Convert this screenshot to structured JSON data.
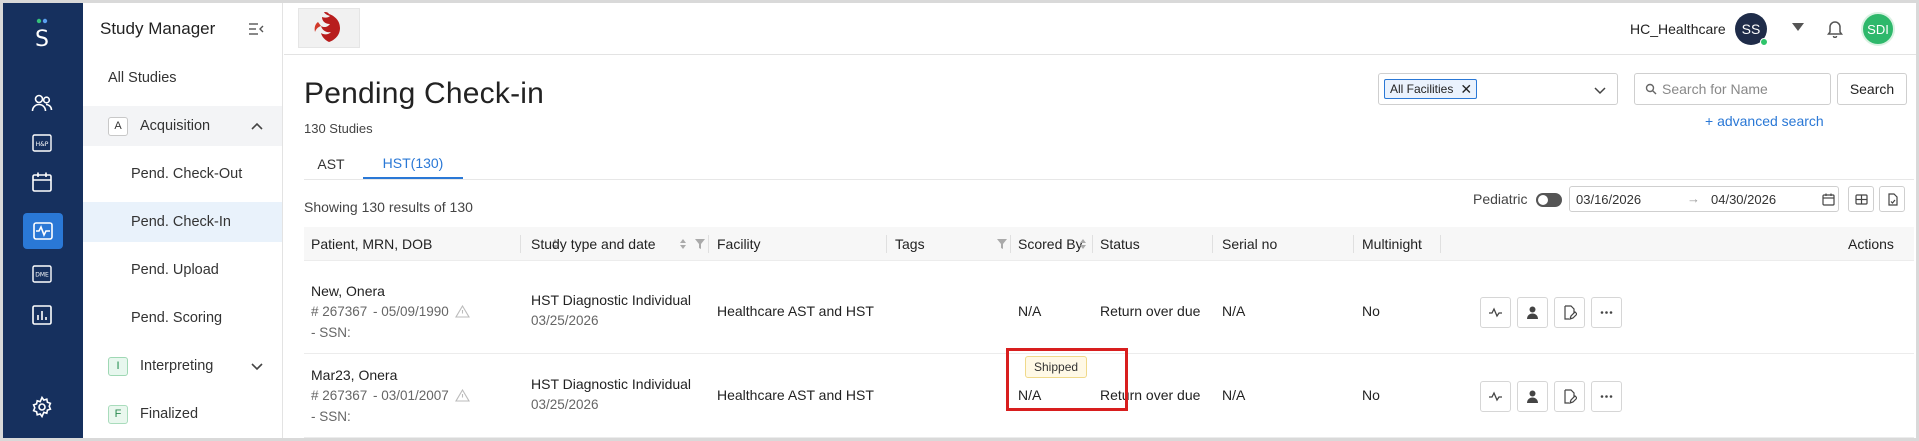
{
  "app": {
    "nav_title": "Study Manager",
    "logo_letter": "S"
  },
  "rail": {
    "icons": [
      "app-logo",
      "users-icon",
      "hp-icon",
      "calendar-icon",
      "studies-icon",
      "dme-icon",
      "reports-icon",
      "settings-icon"
    ],
    "hp_label": "H&P",
    "dme_label": "DME"
  },
  "nav": {
    "all_studies": "All Studies",
    "acquisition": {
      "badge": "A",
      "label": "Acquisition"
    },
    "sub_items": [
      "Pend. Check-Out",
      "Pend. Check-In",
      "Pend. Upload",
      "Pend. Scoring"
    ],
    "interpreting": {
      "badge": "I",
      "label": "Interpreting"
    },
    "finalized": {
      "badge": "F",
      "label": "Finalized"
    }
  },
  "header": {
    "org_name": "HC_Healthcare",
    "avatar_initials": "SS",
    "user_initials": "SDI"
  },
  "page": {
    "title": "Pending Check-in",
    "study_count": "130 Studies",
    "tabs": [
      "AST",
      "HST(130)"
    ],
    "active_tab": "HST(130)",
    "showing": "Showing 130 results of 130"
  },
  "filters": {
    "facility_chip": "All Facilities",
    "search_placeholder": "Search for Name",
    "search_button": "Search",
    "advanced_search": "+ advanced search",
    "pediatric_label": "Pediatric",
    "pediatric_on": false,
    "date_from": "03/16/2026",
    "date_arrow": "→",
    "date_to": "04/30/2026"
  },
  "table": {
    "columns": [
      "Patient, MRN, DOB",
      "Study type and date",
      "Facility",
      "Tags",
      "Scored By",
      "Status",
      "Serial no",
      "Multinight",
      "Actions"
    ],
    "rows": [
      {
        "name": "New, Onera",
        "mrn": "# 267367",
        "dob": "- 05/09/1990",
        "ssn": "- SSN:",
        "study_type": "HST Diagnostic Individual",
        "study_date": "03/25/2026",
        "facility": "Healthcare AST and HST",
        "tag": "",
        "scored_by": "N/A",
        "status": "Return over due",
        "serial": "N/A",
        "multinight": "No"
      },
      {
        "name": "Mar23, Onera",
        "mrn": "# 267367",
        "dob": "- 03/01/2007",
        "ssn": "- SSN:",
        "study_type": "HST Diagnostic Individual",
        "study_date": "03/25/2026",
        "facility": "Healthcare AST and HST",
        "tag": "Shipped",
        "scored_by": "N/A",
        "status": "Return over due",
        "serial": "N/A",
        "multinight": "No"
      }
    ]
  },
  "colors": {
    "rail_bg": "#16305e",
    "accent": "#2a78d6",
    "highlight": "#d81e1e",
    "avatar_green": "#2eb86b"
  }
}
